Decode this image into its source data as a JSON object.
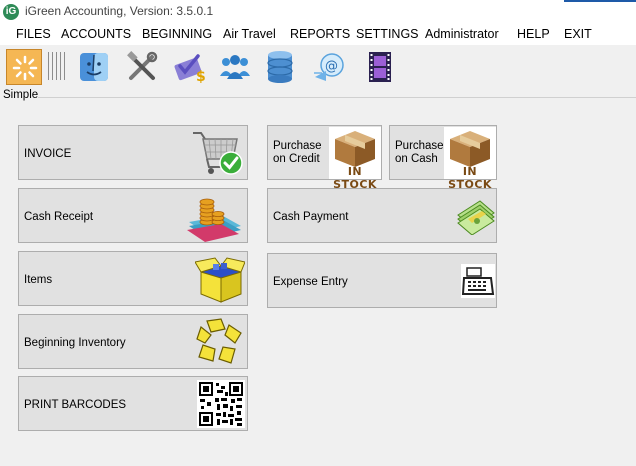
{
  "window": {
    "title": "iGreen Accounting, Version: 3.5.0.1",
    "app_icon_letter": "iG"
  },
  "menu": {
    "items": [
      "FILES",
      "ACCOUNTS",
      "BEGINNING",
      "Air Travel",
      "REPORTS",
      "SETTINGS",
      "Administrator",
      "HELP",
      "EXIT"
    ]
  },
  "toolbar": {
    "icons": [
      "sunburst-icon",
      "finder-icon",
      "tools-icon",
      "check-dollar-icon",
      "users-icon",
      "database-icon",
      "email-icon",
      "film-icon"
    ]
  },
  "section": {
    "label": "Simple"
  },
  "tiles": {
    "invoice": "INVOICE",
    "cash_receipt": "Cash Receipt",
    "items": "Items",
    "beginning_inventory": "Beginning Inventory",
    "print_barcodes": "PRINT BARCODES",
    "purchase_credit": "Purchase on Credit",
    "purchase_cash": "Purchase on Cash",
    "cash_payment": "Cash Payment",
    "expense_entry": "Expense Entry",
    "in_stock": "IN STOCK"
  },
  "colors": {
    "tile_bg": "#e1e1e1",
    "tile_border": "#adadad",
    "active_toolbar": "#f5b754"
  }
}
